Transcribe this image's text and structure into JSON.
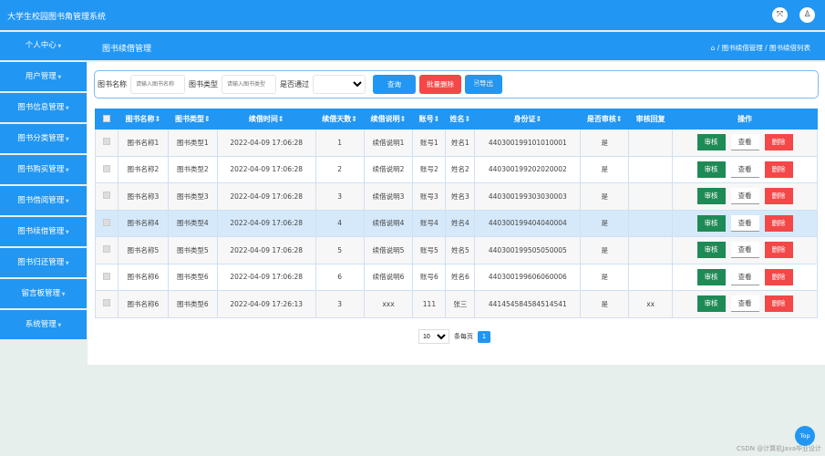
{
  "header": {
    "title": "大学生校园图书角管理系统",
    "fullscreen_icon": "expand-icon",
    "user_icon": "user-icon"
  },
  "subheader": {
    "page_title": "图书续借管理",
    "breadcrumb": {
      "home_icon": "home-icon",
      "items": [
        "图书续借管理",
        "图书续借列表"
      ],
      "separator": "/"
    }
  },
  "sidebar": {
    "items": [
      {
        "label": "个人中心"
      },
      {
        "label": "用户管理"
      },
      {
        "label": "图书信息管理"
      },
      {
        "label": "图书分类管理"
      },
      {
        "label": "图书购买管理"
      },
      {
        "label": "图书借阅管理"
      },
      {
        "label": "图书续借管理"
      },
      {
        "label": "图书归还管理"
      },
      {
        "label": "留言板管理"
      },
      {
        "label": "系统管理"
      }
    ]
  },
  "search": {
    "name_label": "图书名称",
    "name_placeholder": "请输入图书名称",
    "type_label": "图书类型",
    "type_placeholder": "请输入图书类型",
    "pass_label": "是否通过",
    "pass_value": "",
    "query": "查询",
    "batch_delete": "批量删除",
    "export": "导出"
  },
  "table": {
    "headers": [
      "图书名称",
      "图书类型",
      "续借时间",
      "续借天数",
      "续借说明",
      "账号",
      "姓名",
      "身份证",
      "是否审核",
      "审核回复",
      "操作"
    ],
    "rows": [
      [
        "图书名称1",
        "图书类型1",
        "2022-04-09 17:06:28",
        "1",
        "续借说明1",
        "账号1",
        "姓名1",
        "440300199101010001",
        "是",
        ""
      ],
      [
        "图书名称2",
        "图书类型2",
        "2022-04-09 17:06:28",
        "2",
        "续借说明2",
        "账号2",
        "姓名2",
        "440300199202020002",
        "是",
        ""
      ],
      [
        "图书名称3",
        "图书类型3",
        "2022-04-09 17:06:28",
        "3",
        "续借说明3",
        "账号3",
        "姓名3",
        "440300199303030003",
        "是",
        ""
      ],
      [
        "图书名称4",
        "图书类型4",
        "2022-04-09 17:06:28",
        "4",
        "续借说明4",
        "账号4",
        "姓名4",
        "440300199404040004",
        "是",
        ""
      ],
      [
        "图书名称5",
        "图书类型5",
        "2022-04-09 17:06:28",
        "5",
        "续借说明5",
        "账号5",
        "姓名5",
        "440300199505050005",
        "是",
        ""
      ],
      [
        "图书名称6",
        "图书类型6",
        "2022-04-09 17:06:28",
        "6",
        "续借说明6",
        "账号6",
        "姓名6",
        "440300199606060006",
        "是",
        ""
      ],
      [
        "图书名称6",
        "图书类型6",
        "2022-04-09 17:26:13",
        "3",
        "xxx",
        "111",
        "张三",
        "441454584584514541",
        "是",
        "xx"
      ]
    ],
    "actions": {
      "review": "审核",
      "view": "查看",
      "delete": "删除"
    },
    "highlighted_row": 4
  },
  "pager": {
    "page_size": "10",
    "per_page_label": "条每页",
    "current_page": "1"
  },
  "top_button": "Top",
  "watermark": "CSDN @计算机Java毕业设计",
  "colors": {
    "primary": "#2196f3",
    "review": "#1e8a55",
    "delete": "#f44747"
  }
}
